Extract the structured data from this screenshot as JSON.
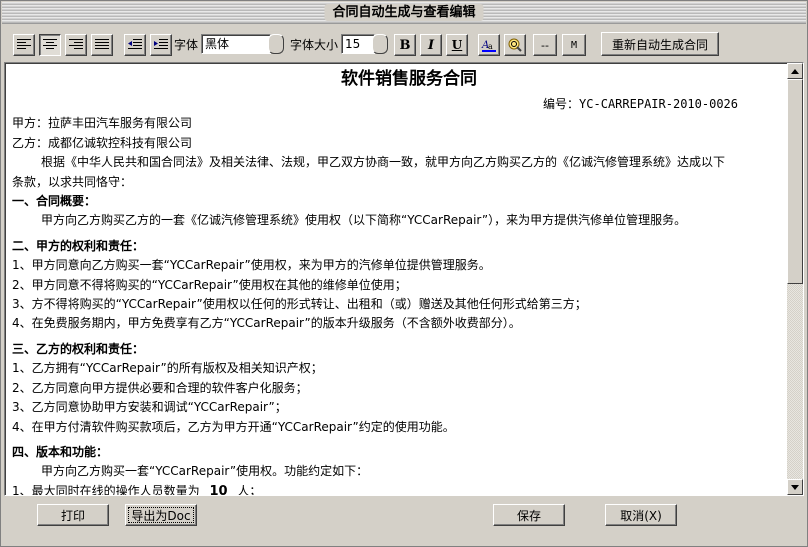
{
  "window": {
    "title": "合同自动生成与查看编辑"
  },
  "toolbar": {
    "font_label": "字体",
    "font_value": "黑体",
    "size_label": "字体大小",
    "size_value": "15",
    "bold_label": "B",
    "italic_label": "I",
    "underline_label": "U",
    "dash_label": "--",
    "m_label": "M",
    "regenerate_label": "重新自动生成合同",
    "active_align": "center"
  },
  "document": {
    "title": "软件销售服务合同",
    "number": "编号：YC-CARREPAIR-2010-0026",
    "party_a": "甲方：拉萨丰田汽车服务有限公司",
    "party_b": "乙方：成都亿诚软控科技有限公司",
    "intro_1": "根据《中华人民共和国合同法》及相关法律、法规，甲乙双方协商一致，就甲方向乙方购买乙方的《亿诚汽修管理系统》达成以下",
    "intro_2": "条款，以求共同恪守：",
    "s1_title": "一、合同概要：",
    "s1_p1": "甲方向乙方购买乙方的一套《亿诚汽修管理系统》使用权（以下简称“YCCarRepair”），来为甲方提供汽修单位管理服务。",
    "s2_title": "二、甲方的权利和责任：",
    "s2_items": [
      "1、甲方同意向乙方购买一套“YCCarRepair”使用权，来为甲方的汽修单位提供管理服务。",
      "2、甲方同意不得将购买的“YCCarRepair”使用权在其他的维修单位使用；",
      "3、方不得将购买的“YCCarRepair”使用权以任何的形式转让、出租和（或）赠送及其他任何形式给第三方；",
      "4、在免费服务期内，甲方免费享有乙方“YCCarRepair”的版本升级服务（不含额外收费部分）。"
    ],
    "s3_title": "三、乙方的权利和责任：",
    "s3_items": [
      "1、乙方拥有“YCCarRepair”的所有版权及相关知识产权；",
      "2、乙方同意向甲方提供必要和合理的软件客户化服务；",
      "3、乙方同意协助甲方安装和调试“YCCarRepair”；",
      "4、在甲方付清软件购买款项后，乙方为甲方开通“YCCarRepair”约定的使用功能。"
    ],
    "s4_title": "四、版本和功能：",
    "s4_p1": "甲方向乙方购买一套“YCCarRepair”使用权。功能约定如下：",
    "s4_item1_prefix": "1、最大同时在线的操作人员数量为",
    "s4_item1_value": "10",
    "s4_item1_suffix": "人；"
  },
  "buttons": {
    "print": "打印",
    "export_doc": "导出为Doc",
    "save": "保存",
    "cancel": "取消(X)"
  }
}
